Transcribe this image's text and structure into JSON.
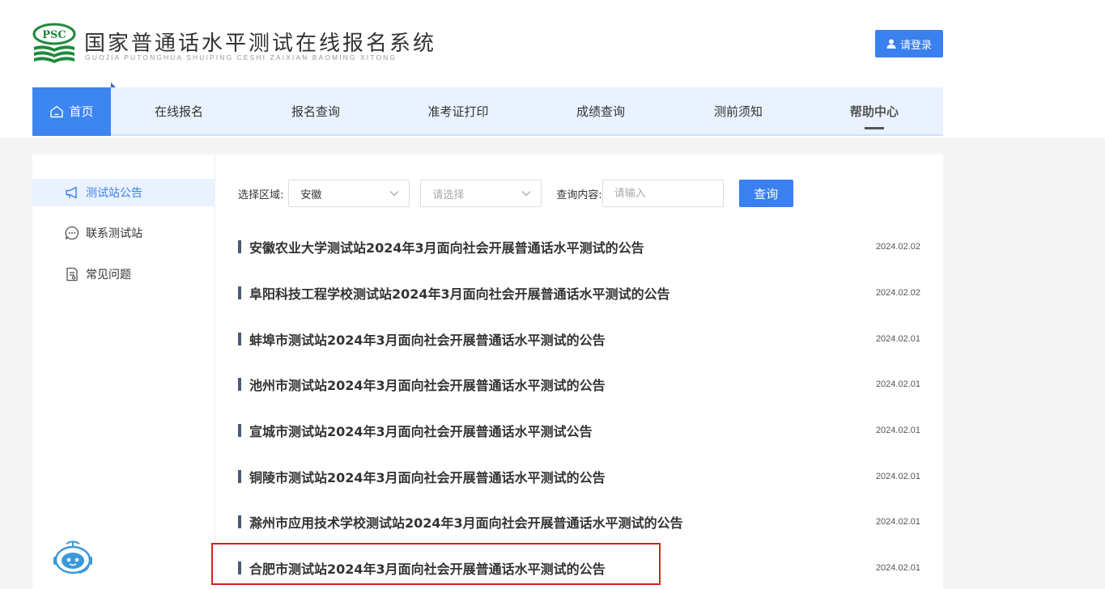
{
  "header": {
    "logo_text": "PSC",
    "title": "国家普通话水平测试在线报名系统",
    "pinyin": "GUOJIA PUTONGHUA SHUIPING CESHI ZAIXIAN BAOMING XITONG",
    "login_label": "请登录"
  },
  "nav": {
    "items": [
      {
        "label": "首页"
      },
      {
        "label": "在线报名"
      },
      {
        "label": "报名查询"
      },
      {
        "label": "准考证打印"
      },
      {
        "label": "成绩查询"
      },
      {
        "label": "测前须知"
      },
      {
        "label": "帮助中心"
      }
    ]
  },
  "sidebar": {
    "items": [
      {
        "label": "测试站公告",
        "icon": "megaphone-icon"
      },
      {
        "label": "联系测试站",
        "icon": "chat-icon"
      },
      {
        "label": "常见问题",
        "icon": "document-icon"
      }
    ]
  },
  "filters": {
    "region_label": "选择区域:",
    "region_value": "安徽",
    "city_placeholder": "请选择",
    "query_label": "查询内容:",
    "query_placeholder": "请输入",
    "query_button": "查询"
  },
  "announcements": [
    {
      "title": "安徽农业大学测试站2024年3月面向社会开展普通话水平测试的公告",
      "date": "2024.02.02"
    },
    {
      "title": "阜阳科技工程学校测试站2024年3月面向社会开展普通话水平测试的公告",
      "date": "2024.02.02"
    },
    {
      "title": "蚌埠市测试站2024年3月面向社会开展普通话水平测试的公告",
      "date": "2024.02.01"
    },
    {
      "title": "池州市测试站2024年3月面向社会开展普通话水平测试的公告",
      "date": "2024.02.01"
    },
    {
      "title": "宣城市测试站2024年3月面向社会开展普通话水平测试公告",
      "date": "2024.02.01"
    },
    {
      "title": "铜陵市测试站2024年3月面向社会开展普通话水平测试的公告",
      "date": "2024.02.01"
    },
    {
      "title": "滁州市应用技术学校测试站2024年3月面向社会开展普通话水平测试的公告",
      "date": "2024.02.01"
    },
    {
      "title": "合肥市测试站2024年3月面向社会开展普通话水平测试的公告",
      "date": "2024.02.01"
    }
  ],
  "colors": {
    "accent": "#3a80ee",
    "nav_bg": "#eaf2ff",
    "logo_green": "#1e8a3c",
    "highlight_border": "#d9201f"
  }
}
